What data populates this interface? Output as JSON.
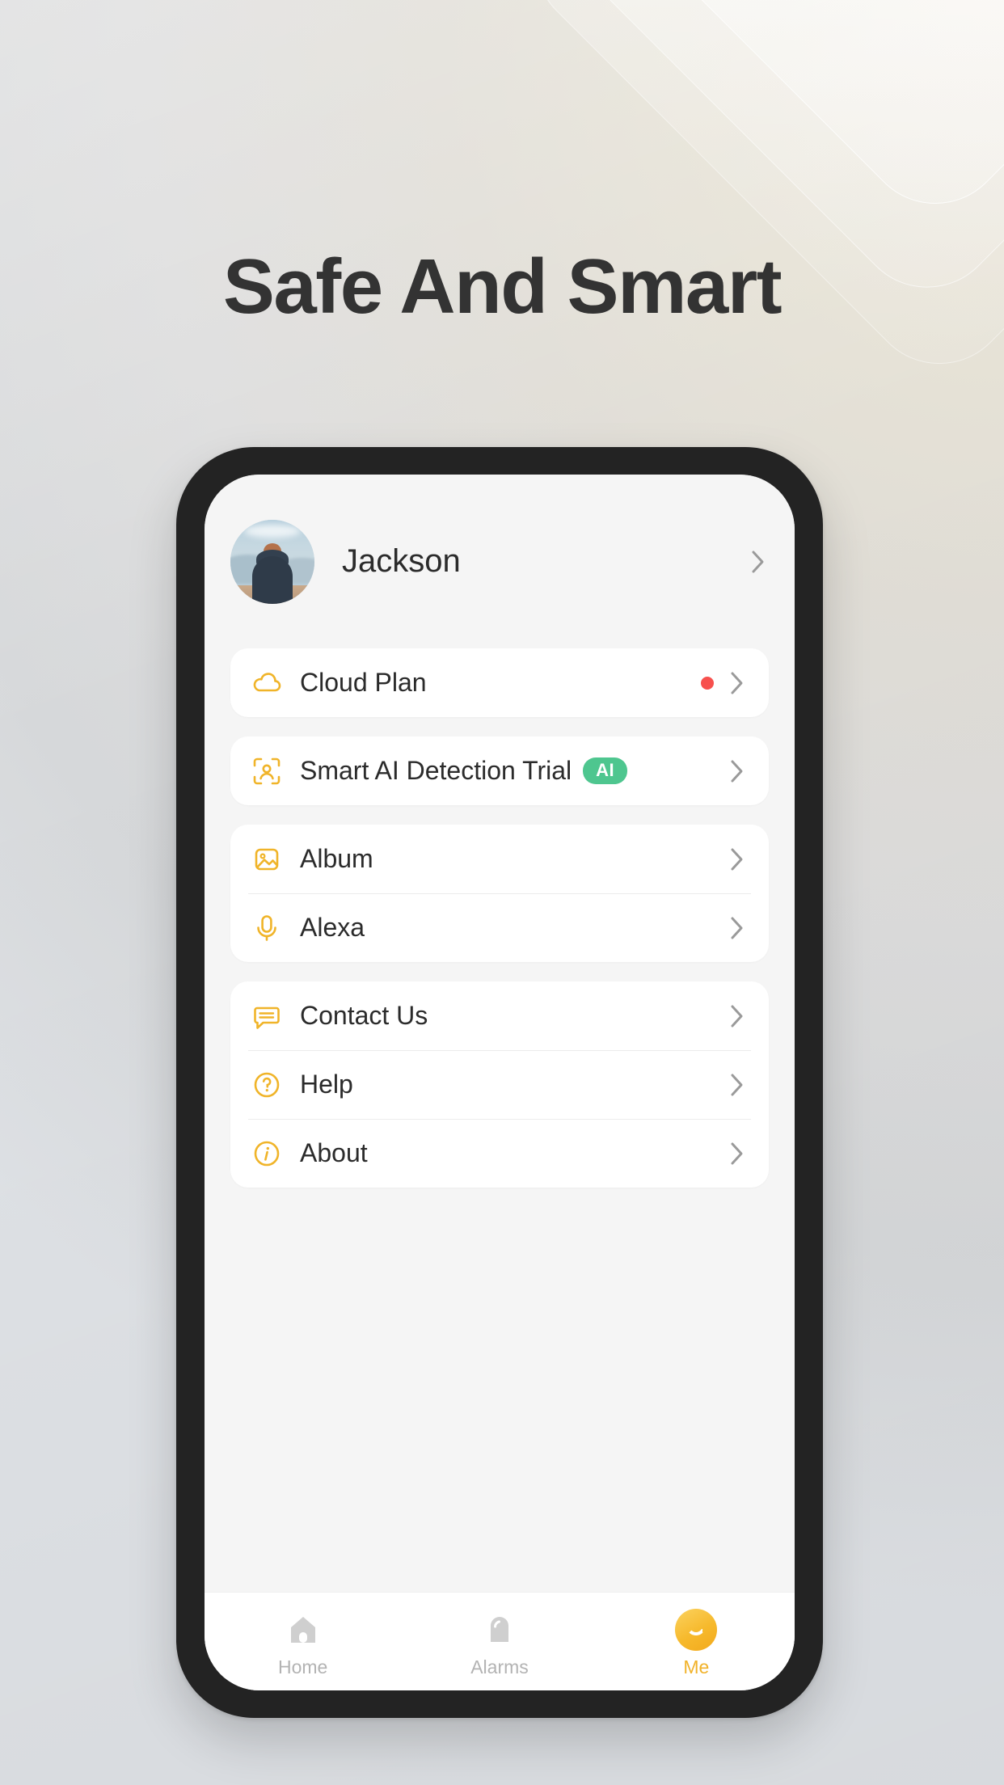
{
  "page": {
    "headline": "Safe And Smart",
    "accent_yellow": "#F0B429",
    "accent_green": "#4EC68F",
    "accent_red": "#F7504D",
    "background_note": "light grey to warm beige gradient with layered translucent rounded squares in top-right"
  },
  "profile": {
    "name": "Jackson",
    "avatar_icon": "user-photo-avatar",
    "chevron_icon": "chevron-right-icon"
  },
  "groups": [
    {
      "rows": [
        {
          "label": "Cloud Plan",
          "icon": "cloud-icon",
          "badge": null,
          "dot": true,
          "chevron": "chevron-right-icon"
        }
      ]
    },
    {
      "rows": [
        {
          "label": "Smart AI Detection Trial",
          "icon": "face-scan-icon",
          "badge": "AI",
          "dot": false,
          "chevron": "chevron-right-icon"
        }
      ]
    },
    {
      "rows": [
        {
          "label": "Album",
          "icon": "image-icon",
          "badge": null,
          "dot": false,
          "chevron": "chevron-right-icon"
        },
        {
          "label": "Alexa",
          "icon": "microphone-icon",
          "badge": null,
          "dot": false,
          "chevron": "chevron-right-icon"
        }
      ]
    },
    {
      "rows": [
        {
          "label": "Contact Us",
          "icon": "chat-bubble-icon",
          "badge": null,
          "dot": false,
          "chevron": "chevron-right-icon"
        },
        {
          "label": "Help",
          "icon": "question-circle-icon",
          "badge": null,
          "dot": false,
          "chevron": "chevron-right-icon"
        },
        {
          "label": "About",
          "icon": "info-circle-icon",
          "badge": null,
          "dot": false,
          "chevron": "chevron-right-icon"
        }
      ]
    }
  ],
  "tabbar": {
    "tabs": [
      {
        "label": "Home",
        "icon": "home-icon",
        "active": false
      },
      {
        "label": "Alarms",
        "icon": "bell-icon",
        "active": false
      },
      {
        "label": "Me",
        "icon": "smiley-face-icon",
        "active": true
      }
    ]
  }
}
